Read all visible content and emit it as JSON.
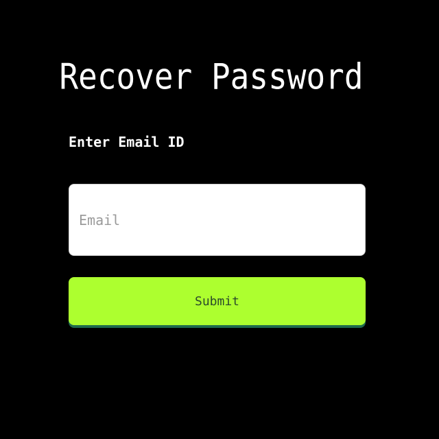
{
  "page": {
    "title": "Recover Password"
  },
  "form": {
    "email_label": "Enter Email ID",
    "email_placeholder": "Email",
    "email_value": "",
    "submit_label": "Submit"
  },
  "colors": {
    "background": "#000000",
    "text": "#ffffff",
    "input_background": "#ffffff",
    "button_background": "#adff2f",
    "button_shadow": "#1f6b4d"
  }
}
